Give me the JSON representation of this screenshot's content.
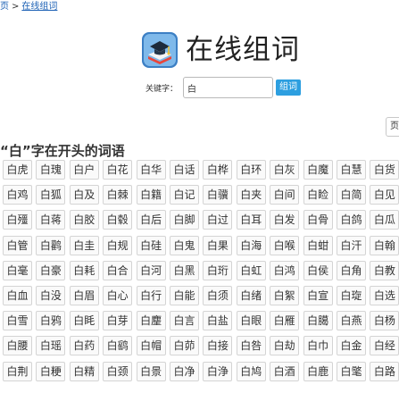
{
  "breadcrumb": {
    "home": "页",
    "separator": ">",
    "current": "在线组词"
  },
  "header": {
    "title": "在线组词",
    "logo_icon": "graduation-cap-book-icon"
  },
  "search": {
    "label": "关键字：",
    "value": "白",
    "button": "组词"
  },
  "edge_box": "页",
  "section": {
    "title": "“白”字在开头的词语"
  },
  "words": [
    [
      "白虎",
      "白瑰",
      "白户",
      "白花",
      "白华",
      "白话",
      "白桦",
      "白环",
      "白灰",
      "白魔",
      "白慧",
      "白货"
    ],
    [
      "白鸡",
      "白狐",
      "白及",
      "白棘",
      "白籍",
      "白记",
      "白骥",
      "白夹",
      "白间",
      "白睑",
      "白简",
      "白见"
    ],
    [
      "白殭",
      "白蒋",
      "白胶",
      "白毂",
      "白后",
      "白脚",
      "白过",
      "白耳",
      "白发",
      "白骨",
      "白鸽",
      "白瓜"
    ],
    [
      "白管",
      "白鹳",
      "白圭",
      "白规",
      "白硅",
      "白鬼",
      "白果",
      "白海",
      "白喉",
      "白蚶",
      "白汗",
      "白翰"
    ],
    [
      "白毫",
      "白豪",
      "白耗",
      "白合",
      "白河",
      "白黑",
      "白珩",
      "白虹",
      "白鸿",
      "白侯",
      "白角",
      "白教"
    ],
    [
      "白血",
      "白没",
      "白眉",
      "白心",
      "白行",
      "白能",
      "白须",
      "白绪",
      "白絮",
      "白宣",
      "白琁",
      "白选"
    ],
    [
      "白雪",
      "白鸦",
      "白眊",
      "白芽",
      "白麈",
      "白言",
      "白盐",
      "白眼",
      "白雁",
      "白臈",
      "白燕",
      "白杨"
    ],
    [
      "白腰",
      "白瑶",
      "白药",
      "白鹞",
      "白帽",
      "白茆",
      "白接",
      "白咎",
      "白劫",
      "白巾",
      "白金",
      "白经"
    ],
    [
      "白荆",
      "白粳",
      "白精",
      "白颈",
      "白景",
      "白净",
      "白浄",
      "白鸠",
      "白酒",
      "白鹿",
      "白氅",
      "白路"
    ]
  ]
}
